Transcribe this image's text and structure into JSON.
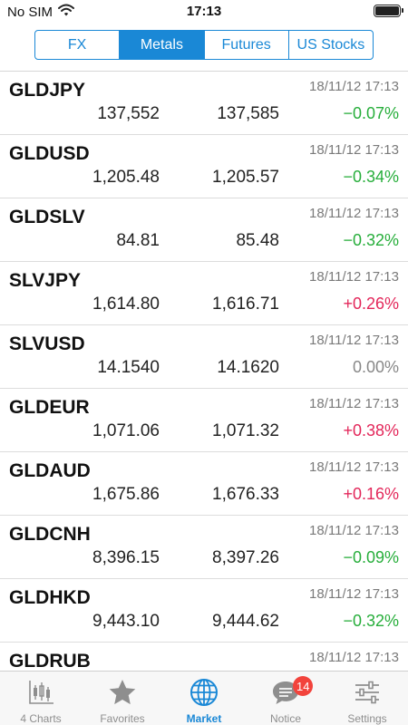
{
  "status_bar": {
    "carrier": "No SIM",
    "time": "17:13"
  },
  "segments": [
    {
      "label": "FX",
      "active": false
    },
    {
      "label": "Metals",
      "active": true
    },
    {
      "label": "Futures",
      "active": false
    },
    {
      "label": "US Stocks",
      "active": false
    }
  ],
  "quotes": [
    {
      "symbol": "GLDJPY",
      "time": "18/11/12 17:13",
      "bid": "137,552",
      "ask": "137,585",
      "change": "−0.07%",
      "direction": "neg"
    },
    {
      "symbol": "GLDUSD",
      "time": "18/11/12 17:13",
      "bid": "1,205.48",
      "ask": "1,205.57",
      "change": "−0.34%",
      "direction": "neg"
    },
    {
      "symbol": "GLDSLV",
      "time": "18/11/12 17:13",
      "bid": "84.81",
      "ask": "85.48",
      "change": "−0.32%",
      "direction": "neg"
    },
    {
      "symbol": "SLVJPY",
      "time": "18/11/12 17:13",
      "bid": "1,614.80",
      "ask": "1,616.71",
      "change": "+0.26%",
      "direction": "pos"
    },
    {
      "symbol": "SLVUSD",
      "time": "18/11/12 17:13",
      "bid": "14.1540",
      "ask": "14.1620",
      "change": "0.00%",
      "direction": "zero"
    },
    {
      "symbol": "GLDEUR",
      "time": "18/11/12 17:13",
      "bid": "1,071.06",
      "ask": "1,071.32",
      "change": "+0.38%",
      "direction": "pos"
    },
    {
      "symbol": "GLDAUD",
      "time": "18/11/12 17:13",
      "bid": "1,675.86",
      "ask": "1,676.33",
      "change": "+0.16%",
      "direction": "pos"
    },
    {
      "symbol": "GLDCNH",
      "time": "18/11/12 17:13",
      "bid": "8,396.15",
      "ask": "8,397.26",
      "change": "−0.09%",
      "direction": "neg"
    },
    {
      "symbol": "GLDHKD",
      "time": "18/11/12 17:13",
      "bid": "9,443.10",
      "ask": "9,444.62",
      "change": "−0.32%",
      "direction": "neg"
    },
    {
      "symbol": "GLDRUB",
      "time": "18/11/12 17:13",
      "bid": "",
      "ask": "",
      "change": "",
      "direction": "neg"
    }
  ],
  "tabs": [
    {
      "label": "4 Charts",
      "icon": "candlestick-chart-icon",
      "active": false
    },
    {
      "label": "Favorites",
      "icon": "star-icon",
      "active": false
    },
    {
      "label": "Market",
      "icon": "globe-icon",
      "active": true
    },
    {
      "label": "Notice",
      "icon": "speech-bubble-icon",
      "active": false,
      "badge": "14"
    },
    {
      "label": "Settings",
      "icon": "sliders-icon",
      "active": false
    }
  ],
  "colors": {
    "accent": "#1a88d6",
    "negative": "#27ae3b",
    "positive": "#e3275a",
    "neutral": "#888888",
    "badge": "#f2433c"
  }
}
